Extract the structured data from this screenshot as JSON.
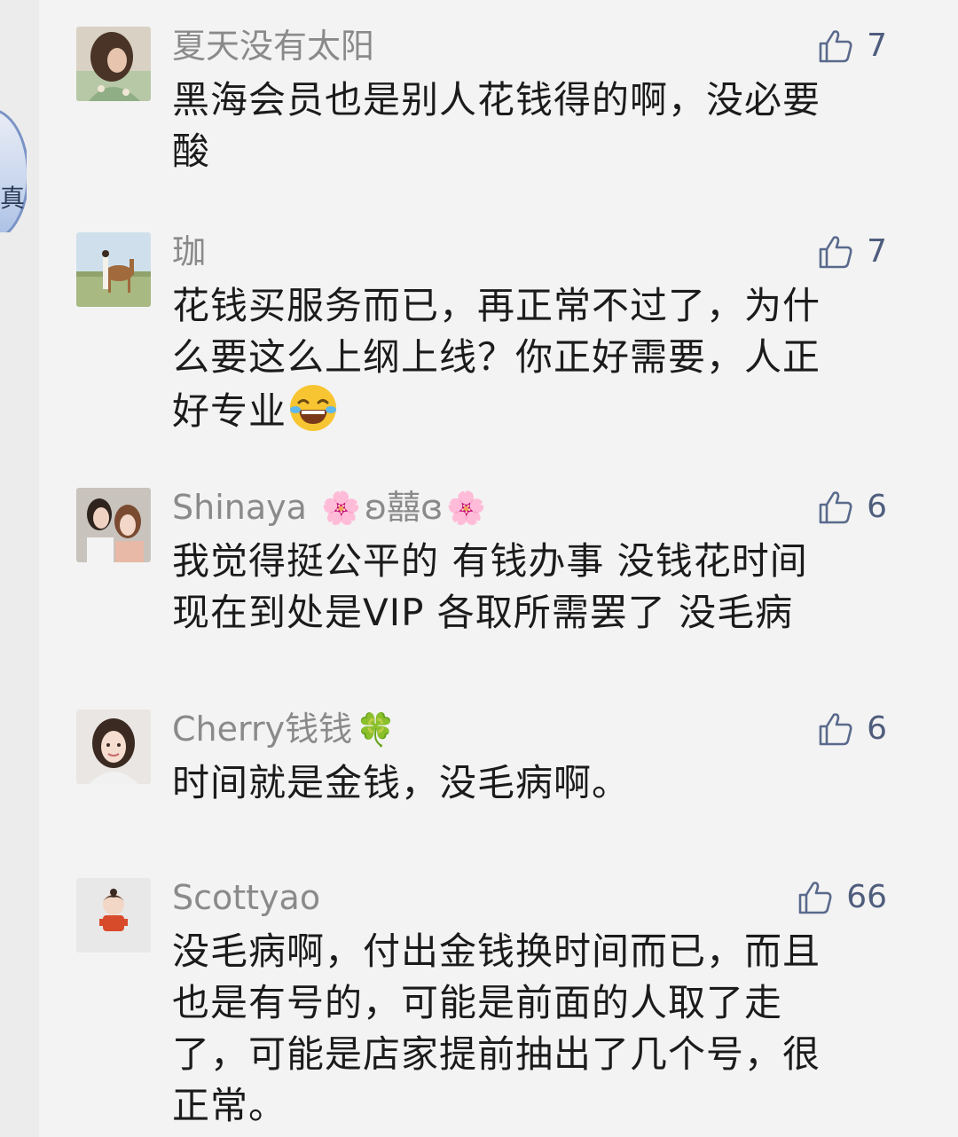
{
  "side": {
    "glyph": "真"
  },
  "comments": [
    {
      "author": "夏天没有太阳",
      "author_emoji_before": "",
      "author_emoji_after": "",
      "likes": "7",
      "text": "黑海会员也是别人花钱得的啊，没必要酸"
    },
    {
      "author": "珈",
      "author_emoji_before": "",
      "author_emoji_after": "",
      "likes": "7",
      "text": "花钱买服务而已，再正常不过了，为什么要这么上纲上线？你正好需要，人正好专业",
      "inline_emoji": "😂"
    },
    {
      "author": "Shinaya",
      "author_emoji_before": "🌸",
      "author_mid": "ʚ囍ɞ",
      "author_emoji_after": "🌸",
      "likes": "6",
      "text": "我觉得挺公平的 有钱办事 没钱花时间 现在到处是VIP 各取所需罢了 没毛病"
    },
    {
      "author": "Cherry钱钱",
      "author_emoji_after": "🍀",
      "likes": "6",
      "text": "时间就是金钱，没毛病啊。"
    },
    {
      "author": "Scottyao",
      "likes": "66",
      "text": "没毛病啊，付出金钱换时间而已，而且也是有号的，可能是前面的人取了走了，可能是店家提前抽出了几个号，很正常。"
    }
  ],
  "icons": {
    "like": "thumbs-up-outline-icon"
  },
  "colors": {
    "background": "#f3f3f3",
    "author": "#8a8a8a",
    "text": "#1b1b1b",
    "like": "#4f5d7d"
  }
}
